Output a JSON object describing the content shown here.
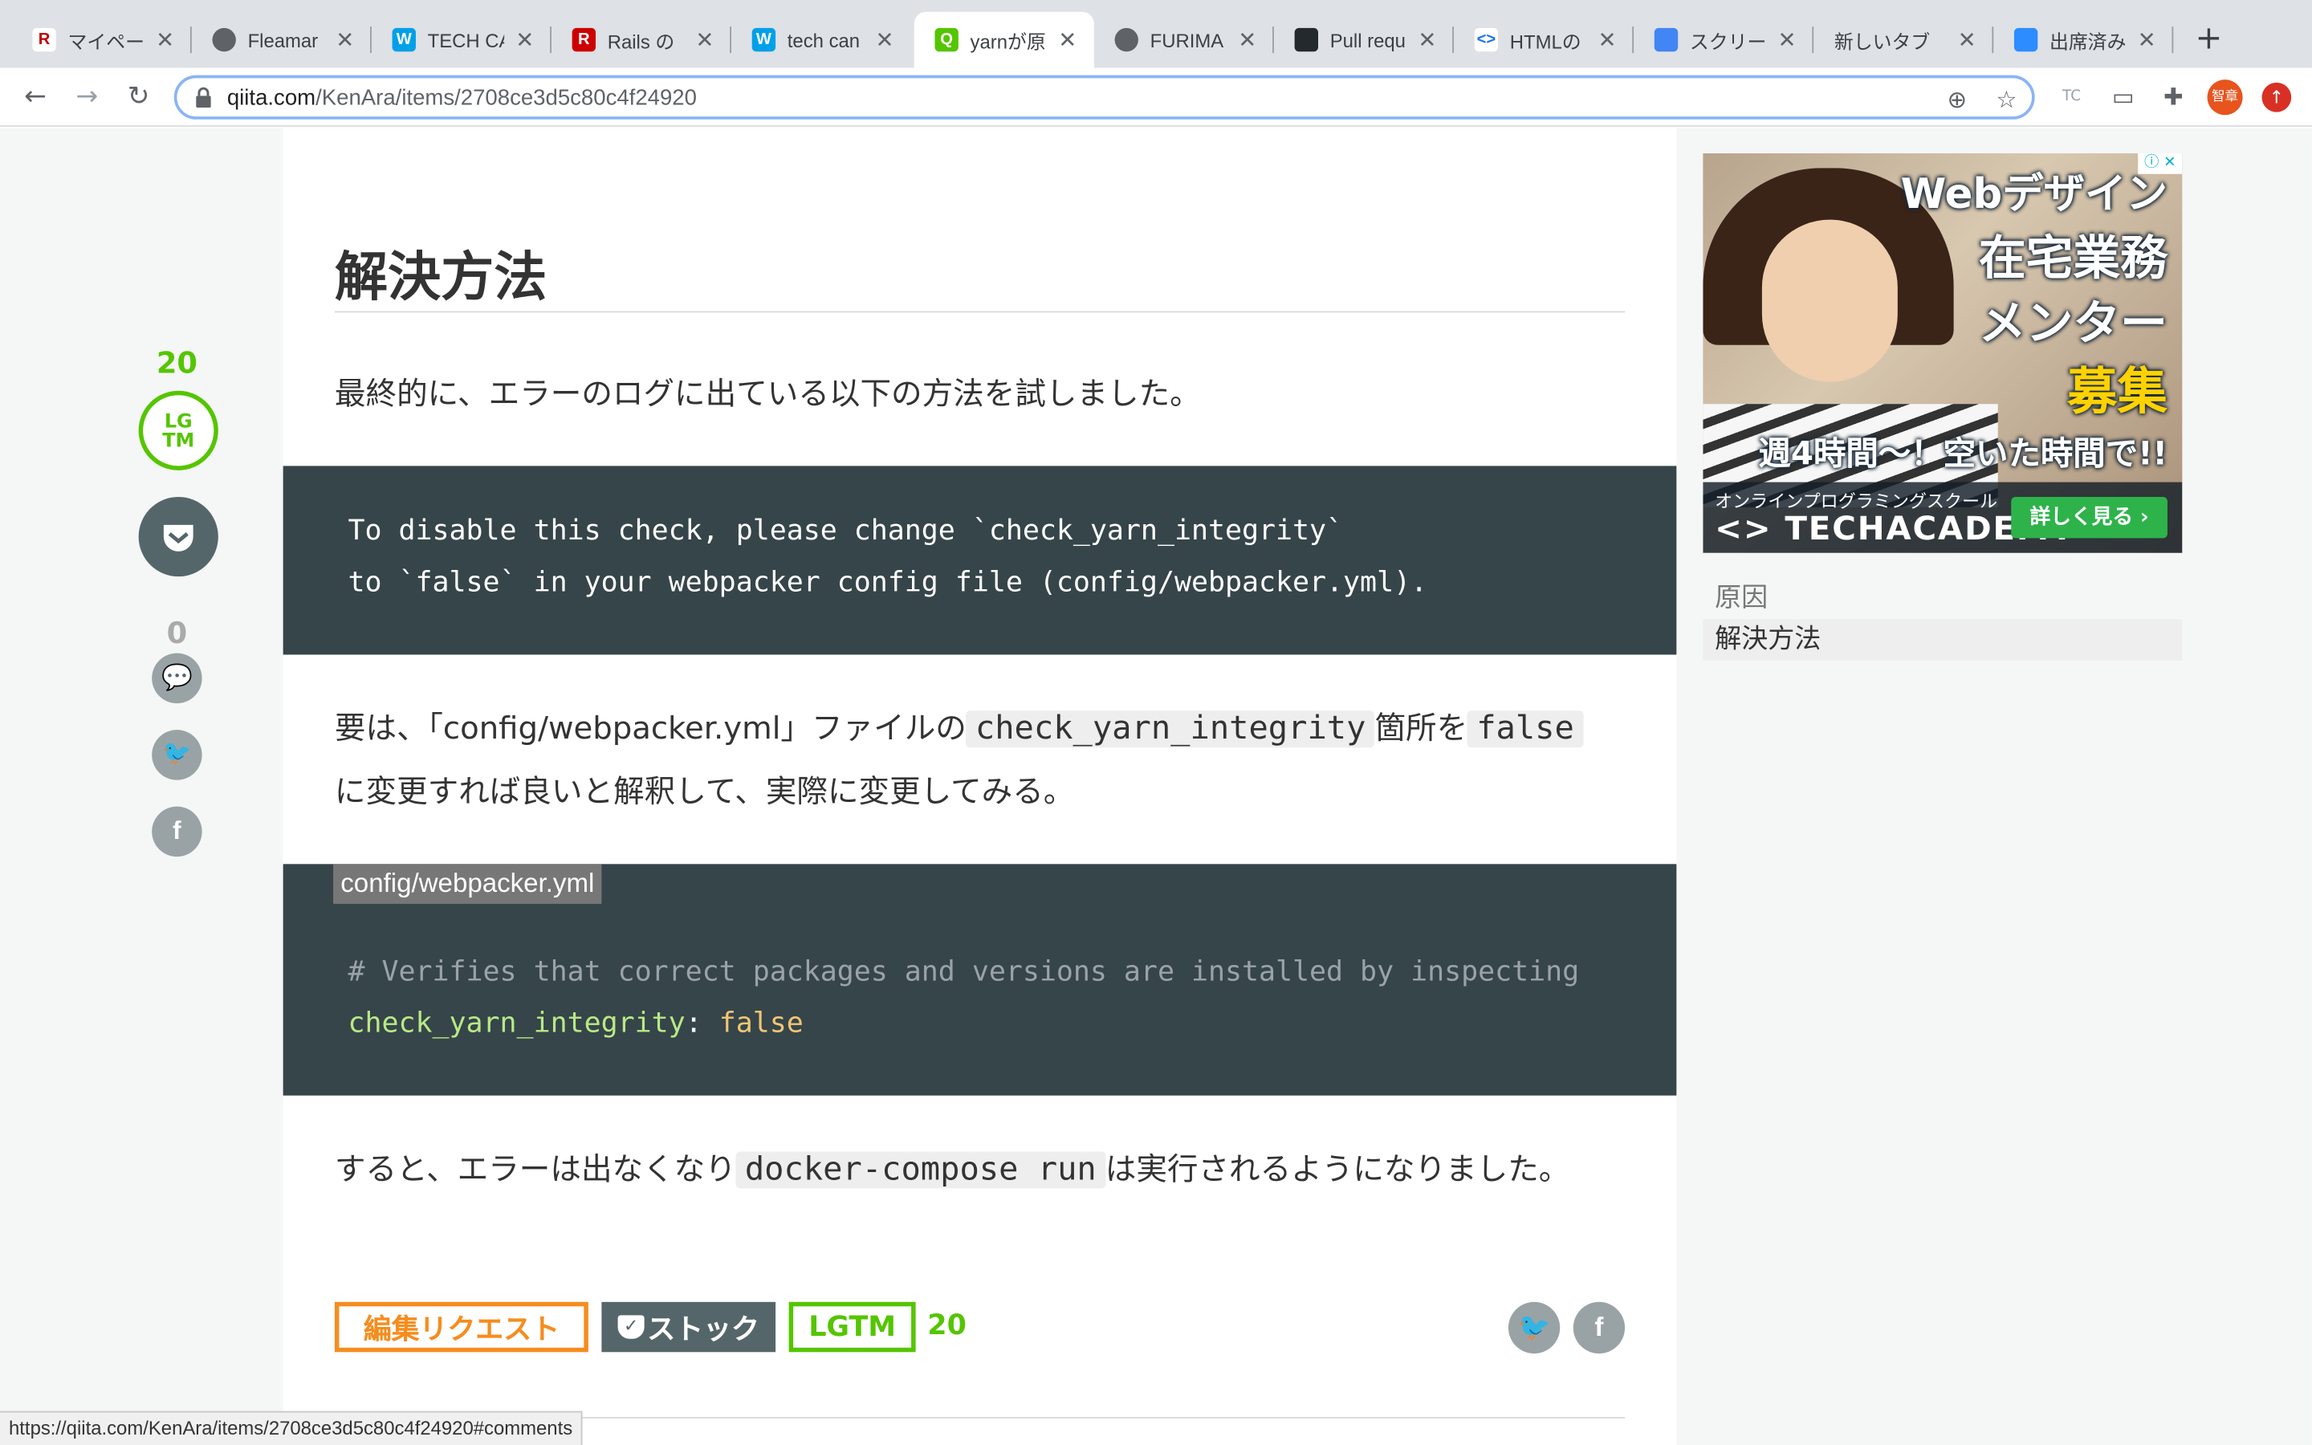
{
  "browser": {
    "tabs": [
      {
        "title": "マイペー",
        "fav_color": "#ffffff",
        "fav_text": "R",
        "fav_text_color": "#bf0000"
      },
      {
        "title": "Fleamar",
        "fav_color": "#5f6368",
        "fav_text": "",
        "fav_text_color": "#ffffff"
      },
      {
        "title": "TECH CA",
        "fav_color": "#00a0e9",
        "fav_text": "W",
        "fav_text_color": "#ffffff"
      },
      {
        "title": "Rails の",
        "fav_color": "#cc0000",
        "fav_text": "R",
        "fav_text_color": "#ffffff"
      },
      {
        "title": "tech can",
        "fav_color": "#00a0e9",
        "fav_text": "W",
        "fav_text_color": "#ffffff"
      },
      {
        "title": "yarnが原",
        "fav_color": "#55c500",
        "fav_text": "Q",
        "fav_text_color": "#ffffff"
      },
      {
        "title": "FURIMA",
        "fav_color": "#5f6368",
        "fav_text": "",
        "fav_text_color": "#ffffff"
      },
      {
        "title": "Pull requ",
        "fav_color": "#24292e",
        "fav_text": "",
        "fav_text_color": "#ffffff"
      },
      {
        "title": "HTMLの",
        "fav_color": "#ffffff",
        "fav_text": "<>",
        "fav_text_color": "#1a73e8"
      },
      {
        "title": "スクリー",
        "fav_color": "#4285f4",
        "fav_text": "",
        "fav_text_color": "#ffffff"
      },
      {
        "title": "新しいタブ",
        "fav_color": "",
        "fav_text": "",
        "fav_text_color": "#ffffff"
      },
      {
        "title": "出席済み",
        "fav_color": "#2d8cff",
        "fav_text": "",
        "fav_text_color": "#ffffff"
      }
    ],
    "new_tab_label": "+",
    "url_host": "qiita.com",
    "url_path": "/KenAra/items/2708ce3d5c80c4f24920",
    "profile_label": "智章",
    "ext_label": "TC"
  },
  "article": {
    "heading": "解決方法",
    "para1": "最終的に、エラーのログに出ている以下の方法を試しました。",
    "code1_line1": "To disable this check, please change `check_yarn_integrity`",
    "code1_line2": "to `false` in your webpacker config file (config/webpacker.yml).",
    "para2_a": "要は、「config/webpacker.yml」ファイルの",
    "para2_code1": "check_yarn_integrity",
    "para2_b": "箇所を",
    "para2_code2": "false",
    "para2_c": "に変更すれば良いと解釈して、実際に変更してみる。",
    "code2_filename": "config/webpacker.yml",
    "code2_comment": "# Verifies that correct packages and versions are installed by inspecting",
    "code2_key": "check_yarn_integrity",
    "code2_colon": ": ",
    "code2_value": "false",
    "para3_a": "すると、エラーは出なくなり",
    "para3_code": "docker-compose run",
    "para3_b": "は実行されるようになりました。",
    "edit_request_label": "編集リクエスト",
    "stock_label": "ストック",
    "lgtm_label": "LGTM",
    "lgtm_count": "20"
  },
  "left_float": {
    "lgtm_count": "20",
    "lgtm_badge": "LG\nTM",
    "comment_count": "0"
  },
  "sidebar": {
    "ad": {
      "line1": "Webデザイン",
      "line2": "在宅業務",
      "line3": "メンター",
      "line4": "募集",
      "line5": "週4時間〜！空いた時間で!!",
      "school": "オンラインプログラミングスクール",
      "brand": "<> TECHACADEMY",
      "cta": "詳しく見る ›",
      "close": "ⓘ ✕"
    },
    "toc": [
      {
        "label": "原因"
      },
      {
        "label": "解決方法"
      }
    ]
  },
  "status_bar": {
    "url": "https://qiita.com/KenAra/items/2708ce3d5c80c4f24920#comments"
  },
  "colors": {
    "qiita_green": "#55c500",
    "code_bg": "#364549",
    "edit_orange": "#f58d1e"
  }
}
